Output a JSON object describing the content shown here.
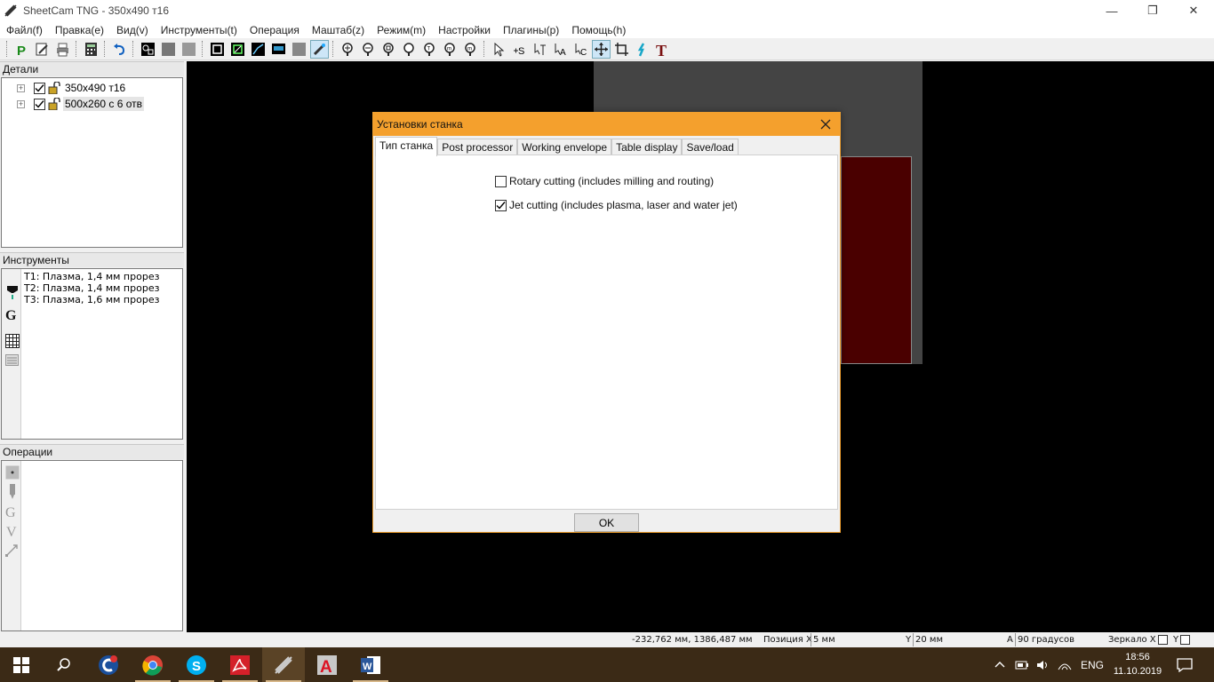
{
  "window": {
    "title": "SheetCam TNG - 350x490 т16",
    "minimize": "—",
    "maximize": "❐",
    "close": "✕"
  },
  "menu": [
    "Файл(f)",
    "Правка(e)",
    "Вид(v)",
    "Инструменты(t)",
    "Операция",
    "Маштаб(z)",
    "Режим(m)",
    "Настройки",
    "Плагины(p)",
    "Помощь(h)"
  ],
  "toolbar": {
    "icons": [
      "p-icon",
      "edit-icon",
      "print-icon",
      "calculator-icon",
      "undo-icon",
      "contour-icon",
      "fill-icon",
      "fill2-icon",
      "part-icon",
      "part-edge-icon",
      "path-icon",
      "display-icon",
      "shade-icon",
      "laser-icon",
      "zoom-in-icon",
      "zoom-out-icon",
      "zoom-window-icon",
      "zoom-fit-icon",
      "zoom-table-icon",
      "zoom-all-icon",
      "zoom-part-icon",
      "select-icon",
      "add-start-icon",
      "node-icon",
      "node-a-icon",
      "node-c-icon",
      "move-icon",
      "crop-icon",
      "torch-icon",
      "text-icon"
    ]
  },
  "details_panel": {
    "title": "Детали",
    "items": [
      {
        "label": "350x490 т16",
        "checked": true,
        "selected": false
      },
      {
        "label": "500x260 с 6 отв",
        "checked": true,
        "selected": true
      }
    ]
  },
  "tools_panel": {
    "title": "Инструменты",
    "items": [
      "T1: Плазма, 1,4 мм прорез",
      "T2: Плазма, 1,4 мм прорез",
      "T3: Плазма, 1,6 мм прорез"
    ]
  },
  "operations_panel": {
    "title": "Операции"
  },
  "dialog": {
    "title": "Установки станка",
    "tabs": [
      "Тип станка",
      "Post processor",
      "Working envelope",
      "Table display",
      "Save/load"
    ],
    "active_tab": "Тип станка",
    "options": [
      {
        "label": "Rotary cutting (includes milling and routing)",
        "checked": false
      },
      {
        "label": "Jet cutting (includes plasma, laser and water jet)",
        "checked": true
      }
    ],
    "ok_label": "OK"
  },
  "statusbar": {
    "coords": "-232,762 мм, 1386,487 мм",
    "pos_x_label": "Позиция X",
    "pos_x_value": "5 мм",
    "y_label": "Y",
    "y_value": "20 мм",
    "a_label": "A",
    "a_value": "90 градусов",
    "mirror_x_label": "Зеркало X",
    "mirror_y_label": "Y"
  },
  "taskbar": {
    "lang": "ENG",
    "time": "18:56",
    "date": "11.10.2019",
    "apps": [
      "start-icon",
      "search-icon",
      "ccleaner-icon",
      "chrome-icon",
      "skype-icon",
      "acrobat-icon",
      "sheetcam-icon",
      "autocad-icon",
      "word-icon"
    ]
  },
  "colors": {
    "dialog_title_bg": "#f4a02d",
    "canvas_bg": "#000000",
    "sheet_grey": "#444444",
    "part_red": "#4a0000",
    "taskbar_bg": "#3b2a16"
  }
}
